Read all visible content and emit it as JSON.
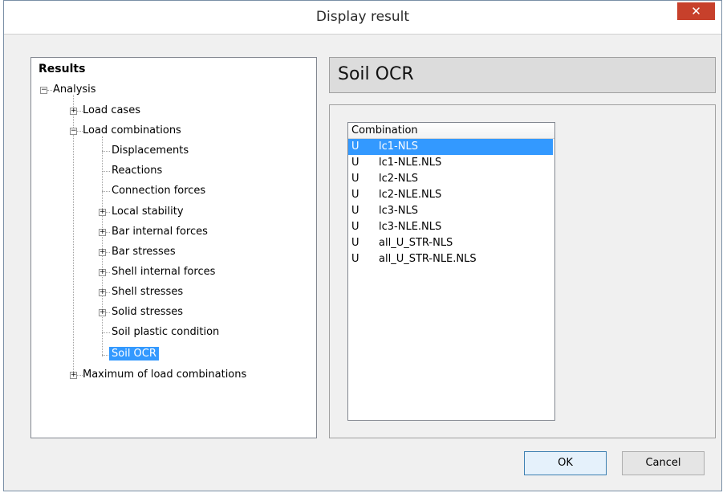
{
  "window": {
    "title": "Display result",
    "close_label": "✕"
  },
  "tree": {
    "root": "Results",
    "nodes": [
      {
        "label": "Analysis",
        "expander": "−"
      },
      {
        "label": "Load cases",
        "expander": "+"
      },
      {
        "label": "Load combinations",
        "expander": "−"
      },
      {
        "label": "Displacements",
        "expander": ""
      },
      {
        "label": "Reactions",
        "expander": ""
      },
      {
        "label": "Connection forces",
        "expander": ""
      },
      {
        "label": "Local stability",
        "expander": "+"
      },
      {
        "label": "Bar internal forces",
        "expander": "+"
      },
      {
        "label": "Bar stresses",
        "expander": "+"
      },
      {
        "label": "Shell internal forces",
        "expander": "+"
      },
      {
        "label": "Shell stresses",
        "expander": "+"
      },
      {
        "label": "Solid stresses",
        "expander": "+"
      },
      {
        "label": "Soil plastic condition",
        "expander": ""
      },
      {
        "label": "Soil OCR",
        "expander": "",
        "selected": true
      },
      {
        "label": "Maximum of load combinations",
        "expander": "+"
      }
    ]
  },
  "header": {
    "title": "Soil OCR"
  },
  "list": {
    "column": "Combination",
    "rows": [
      {
        "type": "U",
        "name": "lc1-NLS",
        "selected": true
      },
      {
        "type": "U",
        "name": "lc1-NLE.NLS"
      },
      {
        "type": "U",
        "name": "lc2-NLS"
      },
      {
        "type": "U",
        "name": "lc2-NLE.NLS"
      },
      {
        "type": "U",
        "name": "lc3-NLS"
      },
      {
        "type": "U",
        "name": "lc3-NLE.NLS"
      },
      {
        "type": "U",
        "name": "all_U_STR-NLS"
      },
      {
        "type": "U",
        "name": "all_U_STR-NLE.NLS"
      }
    ]
  },
  "buttons": {
    "ok": "OK",
    "cancel": "Cancel"
  },
  "colors": {
    "selection": "#3399ff",
    "close": "#c7402b"
  }
}
